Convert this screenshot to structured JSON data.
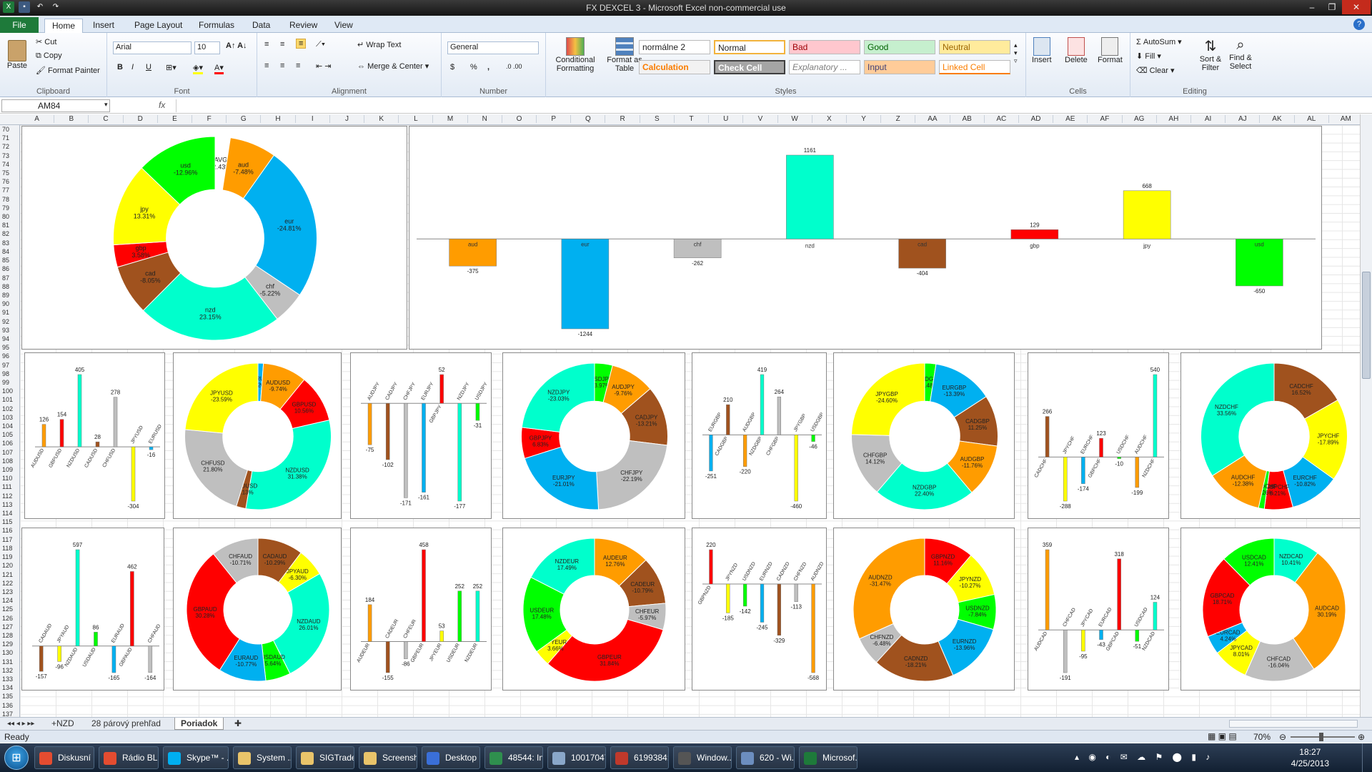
{
  "app": {
    "title": "FX DEXCEL 3  -  Microsoft Excel non-commercial use"
  },
  "tabs": [
    "File",
    "Home",
    "Insert",
    "Page Layout",
    "Formulas",
    "Data",
    "Review",
    "View"
  ],
  "ribbon": {
    "clipboard": {
      "label": "Clipboard",
      "paste": "Paste",
      "cut": "Cut",
      "copy": "Copy",
      "format_painter": "Format Painter"
    },
    "font": {
      "label": "Font",
      "name": "Arial",
      "size": "10",
      "bold": "B",
      "italic": "I",
      "underline": "U"
    },
    "alignment": {
      "label": "Alignment",
      "wrap": "Wrap Text",
      "merge": "Merge & Center"
    },
    "number": {
      "label": "Number",
      "format": "General",
      "currency": "$",
      "percent": "%",
      "comma": ","
    },
    "styles": {
      "label": "Styles",
      "conditional": "Conditional Formatting",
      "format_table": "Format as Table",
      "items": [
        "normálne 2",
        "Normal",
        "Bad",
        "Good",
        "Neutral",
        "Calculation",
        "Check Cell",
        "Explanatory ...",
        "Input",
        "Linked Cell"
      ]
    },
    "cells": {
      "label": "Cells",
      "insert": "Insert",
      "delete": "Delete",
      "format": "Format"
    },
    "editing": {
      "label": "Editing",
      "autosum": "AutoSum",
      "fill": "Fill",
      "clear": "Clear",
      "sort": "Sort & Filter",
      "find": "Find & Select"
    }
  },
  "formula_bar": {
    "cell": "AM84",
    "fx": "fx",
    "value": ""
  },
  "columns": [
    "A",
    "B",
    "C",
    "D",
    "E",
    "F",
    "G",
    "H",
    "I",
    "J",
    "K",
    "L",
    "M",
    "N",
    "O",
    "P",
    "Q",
    "R",
    "S",
    "T",
    "U",
    "V",
    "W",
    "X",
    "Y",
    "Z",
    "AA",
    "AB",
    "AC",
    "AD",
    "AE",
    "AF",
    "AG",
    "AH",
    "AI",
    "AJ",
    "AK",
    "AL",
    "AM"
  ],
  "rows": {
    "first": 70,
    "last": 137
  },
  "sheet_tabs": [
    "+NZD",
    "28 párový prehľad",
    "Poriadok"
  ],
  "status": {
    "ready": "Ready",
    "zoom": "70%"
  },
  "colors": {
    "aud": "#ff9c00",
    "eur": "#00b0f0",
    "chf": "#bfbfbf",
    "nzd": "#00ffcc",
    "cad": "#a0521e",
    "gbp": "#ff0000",
    "jpy": "#ffff00",
    "usd": "#00ff00",
    "avg": "#ffffff"
  },
  "taskbar": {
    "items": [
      "Diskusní ...",
      "Rádio BL...",
      "Skype™ - ...",
      "System ...",
      "SIGTrader",
      "Screensh...",
      "Desktop",
      "48544: In...",
      "10017047...",
      "6199384: ...",
      "Window...",
      "620 - Wi...",
      "Microsof..."
    ],
    "time": "18:27",
    "date": "4/25/2013"
  },
  "chart_data": [
    {
      "type": "pie",
      "categories": [
        "AVG",
        "aud",
        "eur",
        "chf",
        "nzd",
        "cad",
        "gbp",
        "jpy",
        "usd"
      ],
      "values": [
        2.43,
        7.48,
        24.81,
        5.22,
        23.15,
        8.05,
        3.58,
        13.31,
        12.96
      ],
      "labels": [
        "AVG -2.43%",
        "aud -7.48%",
        "eur -24.81%",
        "chf -5.22%",
        "nzd 23.15%",
        "cad -8.05%",
        "gbp 3.58%",
        "jpy 13.31%",
        "usd -12.96%"
      ]
    },
    {
      "type": "bar",
      "categories": [
        "aud",
        "eur",
        "chf",
        "nzd",
        "cad",
        "gbp",
        "jpy",
        "usd"
      ],
      "values": [
        -375,
        -1244,
        -262,
        1161,
        -404,
        129,
        668,
        -650
      ]
    },
    {
      "type": "bar",
      "categories": [
        "AUDUSD",
        "GBPUSD",
        "NZDUSD",
        "CADUSD",
        "CHFUSD",
        "JPYUSD",
        "EURUSD"
      ],
      "values": [
        126,
        154,
        405,
        28,
        278,
        -304,
        -16
      ]
    },
    {
      "type": "pie",
      "categories": [
        "EURUSD",
        "AUDUSD",
        "GBPUSD",
        "NZDUSD",
        "CADUSD",
        "CHFUSD",
        "JPYUSD"
      ],
      "values": [
        1.2,
        9.74,
        10.56,
        31.38,
        2.13,
        21.8,
        23.59
      ],
      "labels": [
        "EURUSD -1.20%",
        "AUDUSD -9.74%",
        "GBPUSD 10.56%",
        "NZDUSD 31.38%",
        "CADUSD 2.13%",
        "CHFUSD 21.80%",
        "JPYUSD -23.59%"
      ]
    },
    {
      "type": "bar",
      "categories": [
        "AUDJPY",
        "CADJPY",
        "CHFJPY",
        "EURJPY",
        "GBPJPY",
        "NZDJPY",
        "USDJPY"
      ],
      "values": [
        -75,
        -102,
        -171,
        -161,
        52,
        -177,
        -31
      ]
    },
    {
      "type": "pie",
      "categories": [
        "USDJPY",
        "AUDJPY",
        "CADJPY",
        "CHFJPY",
        "EURJPY",
        "GBPJPY",
        "NZDJPY"
      ],
      "values": [
        3.97,
        9.76,
        13.21,
        22.19,
        21.01,
        6.83,
        23.03
      ],
      "labels": [
        "USDJPY -3.97%",
        "AUDJPY -9.76%",
        "CADJPY -13.21%",
        "CHFJPY -22.19%",
        "EURJPY -21.01%",
        "GBPJPY 6.83%",
        "NZDJPY -23.03%"
      ]
    },
    {
      "type": "bar",
      "categories": [
        "EURGBP",
        "CADGBP",
        "AUDGBP",
        "NZDGBP",
        "CHFGBP",
        "JPYGBP",
        "USDGBP"
      ],
      "values": [
        -251,
        210,
        -220,
        419,
        264,
        -460,
        -46
      ]
    },
    {
      "type": "pie",
      "categories": [
        "USDGBP",
        "EURGBP",
        "CADGBP",
        "AUDGBP",
        "NZDGBP",
        "CHFGBP",
        "JPYGBP"
      ],
      "values": [
        2.48,
        13.39,
        11.25,
        11.76,
        22.4,
        14.12,
        24.6
      ],
      "labels": [
        "USDGBP -2.48%",
        "EURGBP -13.39%",
        "CADGBP 11.25%",
        "AUDGBP -11.76%",
        "NZDGBP 22.40%",
        "CHFGBP 14.12%",
        "JPYGBP -24.60%"
      ]
    },
    {
      "type": "bar",
      "categories": [
        "CADCHF",
        "JPYCHF",
        "EURCHF",
        "GBPCHF",
        "USDCHF",
        "AUDCHF",
        "NZDCHF"
      ],
      "values": [
        266,
        -288,
        -174,
        123,
        -10,
        -199,
        540
      ]
    },
    {
      "type": "pie",
      "categories": [
        "CADCHF",
        "JPYCHF",
        "EURCHF",
        "GBPCHF",
        "USDCHF",
        "AUDCHF",
        "NZDCHF"
      ],
      "values": [
        16.52,
        17.89,
        10.82,
        6.21,
        1.26,
        12.38,
        33.56
      ],
      "labels": [
        "CADCHF 16.52%",
        "JPYCHF -17.89%",
        "EURCHF -10.82%",
        "GBPCHF 6.21%",
        "USDCHF -1.26%",
        "AUDCHF -12.38%",
        "NZDCHF 33.56%"
      ]
    },
    {
      "type": "bar",
      "categories": [
        "CADAUD",
        "JPYAUD",
        "NZDAUD",
        "USDAUD",
        "EURAUD",
        "GBPAUD",
        "CHFAUD"
      ],
      "values": [
        -157,
        -96,
        597,
        86,
        -165,
        462,
        -164
      ]
    },
    {
      "type": "pie",
      "categories": [
        "CADAUD",
        "JPYAUD",
        "NZDAUD",
        "USDAUD",
        "EURAUD",
        "GBPAUD",
        "CHFAUD"
      ],
      "values": [
        10.29,
        6.3,
        26.01,
        5.64,
        10.77,
        30.28,
        10.71
      ],
      "labels": [
        "CADAUD -10.29%",
        "JPYAUD -6.30%",
        "NZDAUD 26.01%",
        "USDAUD 5.64%",
        "EURAUD -10.77%",
        "GBPAUD 30.28%",
        "CHFAUD -10.71%"
      ]
    },
    {
      "type": "bar",
      "categories": [
        "AUDEUR",
        "CADEUR",
        "CHFEUR",
        "GBPEUR",
        "JPYEUR",
        "USDEUR",
        "NZDEUR"
      ],
      "values": [
        184,
        -155,
        -86,
        458,
        53,
        252,
        252
      ]
    },
    {
      "type": "pie",
      "categories": [
        "AUDEUR",
        "CADEUR",
        "CHFEUR",
        "GBPEUR",
        "JPYEUR",
        "USDEUR",
        "NZDEUR"
      ],
      "values": [
        12.76,
        10.79,
        5.97,
        31.84,
        3.66,
        17.48,
        17.49
      ],
      "labels": [
        "AUDEUR 12.76%",
        "CADEUR -10.79%",
        "CHFEUR -5.97%",
        "GBPEUR 31.84%",
        "JPYEUR 3.66%",
        "USDEUR 17.48%",
        "NZDEUR 17.49%"
      ]
    },
    {
      "type": "bar",
      "categories": [
        "GBPNZD",
        "JPYNZD",
        "USDNZD",
        "EURNZD",
        "CADNZD",
        "CHFNZD",
        "AUDNZD"
      ],
      "values": [
        220,
        -185,
        -142,
        -245,
        -329,
        -113,
        -568
      ]
    },
    {
      "type": "pie",
      "categories": [
        "GBPNZD",
        "JPYNZD",
        "USDNZD",
        "EURNZD",
        "CADNZD",
        "CHFNZD",
        "AUDNZD"
      ],
      "values": [
        11.16,
        10.27,
        7.84,
        13.96,
        18.21,
        6.48,
        31.47
      ],
      "labels": [
        "GBPNZD 11.16%",
        "JPYNZD -10.27%",
        "USDNZD -7.84%",
        "EURNZD -13.96%",
        "CADNZD -18.21%",
        "CHFNZD -6.48%",
        "AUDNZD -31.47%"
      ]
    },
    {
      "type": "bar",
      "categories": [
        "AUDCAD",
        "CHFCAD",
        "JPYCAD",
        "EURCAD",
        "GBPCAD",
        "USDCAD",
        "NZDCAD"
      ],
      "values": [
        359,
        -191,
        -95,
        -43,
        318,
        -51,
        124
      ]
    },
    {
      "type": "pie",
      "categories": [
        "NZDCAD",
        "AUDCAD",
        "CHFCAD",
        "JPYCAD",
        "EURCAD",
        "GBPCAD",
        "USDCAD"
      ],
      "values": [
        10.41,
        30.19,
        16.04,
        8.01,
        4.24,
        18.71,
        12.41
      ],
      "labels": [
        "NZDCAD 10.41%",
        "AUDCAD 30.19%",
        "CHFCAD -16.04%",
        "JPYCAD 8.01%",
        "EURCAD 4.24%",
        "GBPCAD 18.71%",
        "USDCAD 12.41%"
      ]
    }
  ]
}
